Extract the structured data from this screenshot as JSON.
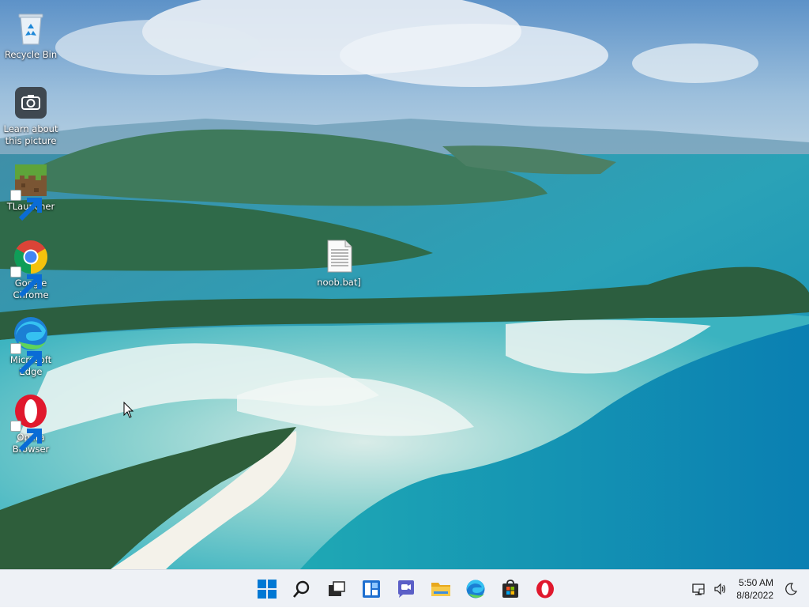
{
  "desktop": {
    "icons": [
      {
        "label": "Recycle Bin",
        "icon": "recycle-bin-icon",
        "shortcut": false
      },
      {
        "label": "Learn about this picture",
        "icon": "camera-icon",
        "shortcut": false
      },
      {
        "label": "TLauncher",
        "icon": "minecraft-grass-block-icon",
        "shortcut": true
      },
      {
        "label": "Google Chrome",
        "icon": "chrome-icon",
        "shortcut": true
      },
      {
        "label": "Microsoft Edge",
        "icon": "edge-icon",
        "shortcut": true
      },
      {
        "label": "Opera Browser",
        "icon": "opera-icon",
        "shortcut": true
      },
      {
        "label": "noob.bat]",
        "icon": "text-file-icon",
        "shortcut": false
      }
    ]
  },
  "taskbar": {
    "apps": [
      {
        "name": "Start",
        "icon": "windows-start-icon"
      },
      {
        "name": "Search",
        "icon": "search-icon"
      },
      {
        "name": "Task View",
        "icon": "task-view-icon"
      },
      {
        "name": "Widgets",
        "icon": "widgets-icon"
      },
      {
        "name": "Chat",
        "icon": "chat-icon"
      },
      {
        "name": "File Explorer",
        "icon": "folder-icon"
      },
      {
        "name": "Microsoft Edge",
        "icon": "edge-icon"
      },
      {
        "name": "Microsoft Store",
        "icon": "store-icon"
      },
      {
        "name": "Opera",
        "icon": "opera-icon"
      }
    ],
    "tray": {
      "network_icon": "network-icon",
      "volume_icon": "volume-icon",
      "time": "5:50 AM",
      "date": "8/8/2022",
      "focus_icon": "moon-icon"
    }
  },
  "colors": {
    "taskbar_bg": "#eef1f6",
    "accent_blue": "#0078d4",
    "opera_red": "#e0182d"
  }
}
